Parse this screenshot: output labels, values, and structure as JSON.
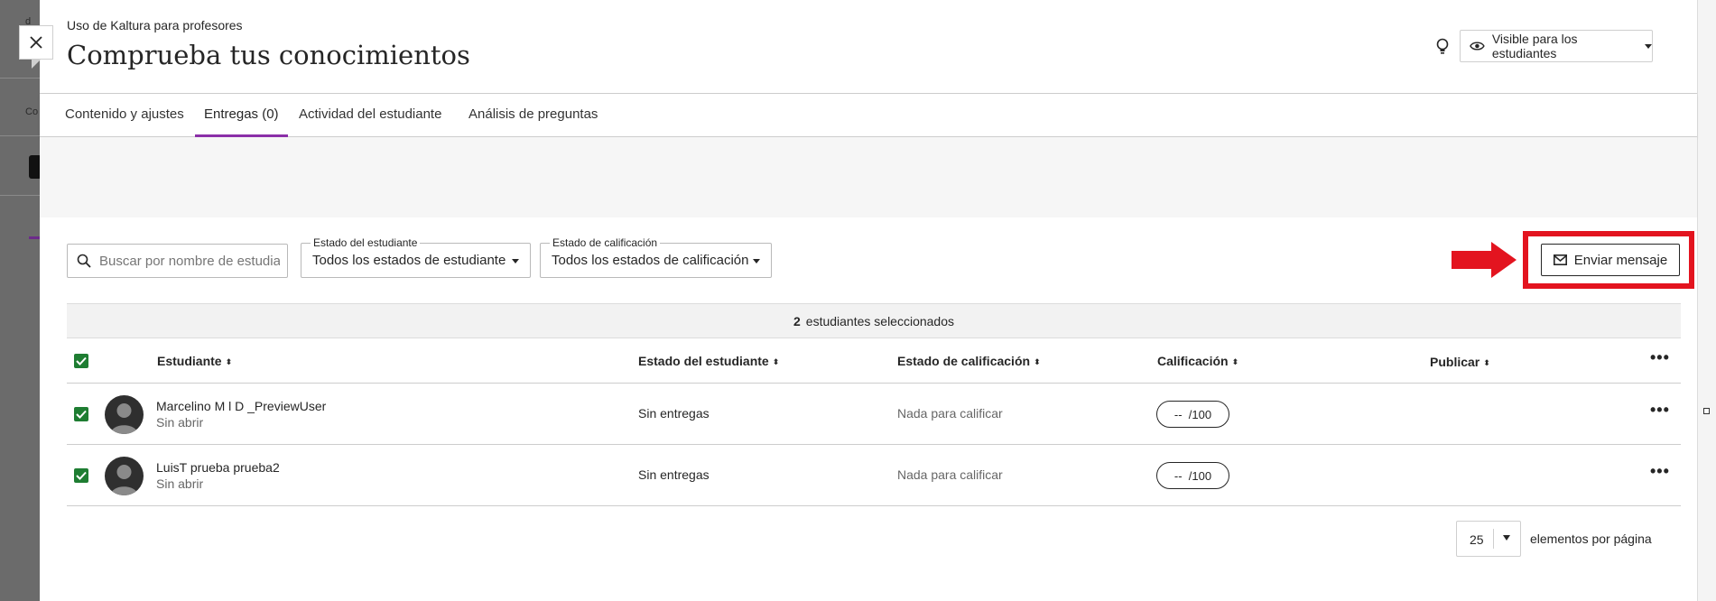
{
  "background": {
    "tab_fragment": "Co",
    "top_fragment": "d"
  },
  "header": {
    "breadcrumb": "Uso de Kaltura para profesores",
    "title": "Comprueba tus conocimientos",
    "visibility_label": "Visible para los estudiantes"
  },
  "tabs": [
    {
      "label": "Contenido y ajustes",
      "active": false
    },
    {
      "label": "Entregas (0)",
      "active": true
    },
    {
      "label": "Actividad del estudiante",
      "active": false
    },
    {
      "label": "Análisis de preguntas",
      "active": false
    }
  ],
  "filters": {
    "search_placeholder": "Buscar por nombre de estudiante",
    "student_status": {
      "legend": "Estado del estudiante",
      "value": "Todos los estados de estudiante"
    },
    "grade_status": {
      "legend": "Estado de calificación",
      "value": "Todos los estados de calificación"
    }
  },
  "send_message": {
    "label": "Enviar mensaje",
    "highlight_color": "#e3141f"
  },
  "selection": {
    "count": "2",
    "label": "estudiantes seleccionados"
  },
  "columns": {
    "student": "Estudiante",
    "student_status": "Estado del estudiante",
    "grade_status": "Estado de calificación",
    "grade": "Calificación",
    "publish": "Publicar"
  },
  "rows": [
    {
      "name": "Marcelino M  l D   _PreviewUser",
      "status": "Sin abrir",
      "student_status": "Sin entregas",
      "grade_status": "Nada para calificar",
      "grade_value": "--",
      "grade_max": "/100",
      "checked": true
    },
    {
      "name": "LuisT prueba prueba2",
      "status": "Sin abrir",
      "student_status": "Sin entregas",
      "grade_status": "Nada para calificar",
      "grade_value": "--",
      "grade_max": "/100",
      "checked": true
    }
  ],
  "pagination": {
    "per_page": "25",
    "label": "elementos por página"
  },
  "colors": {
    "accent_purple": "#8b2fa8",
    "checkbox_green": "#1e7d32"
  }
}
